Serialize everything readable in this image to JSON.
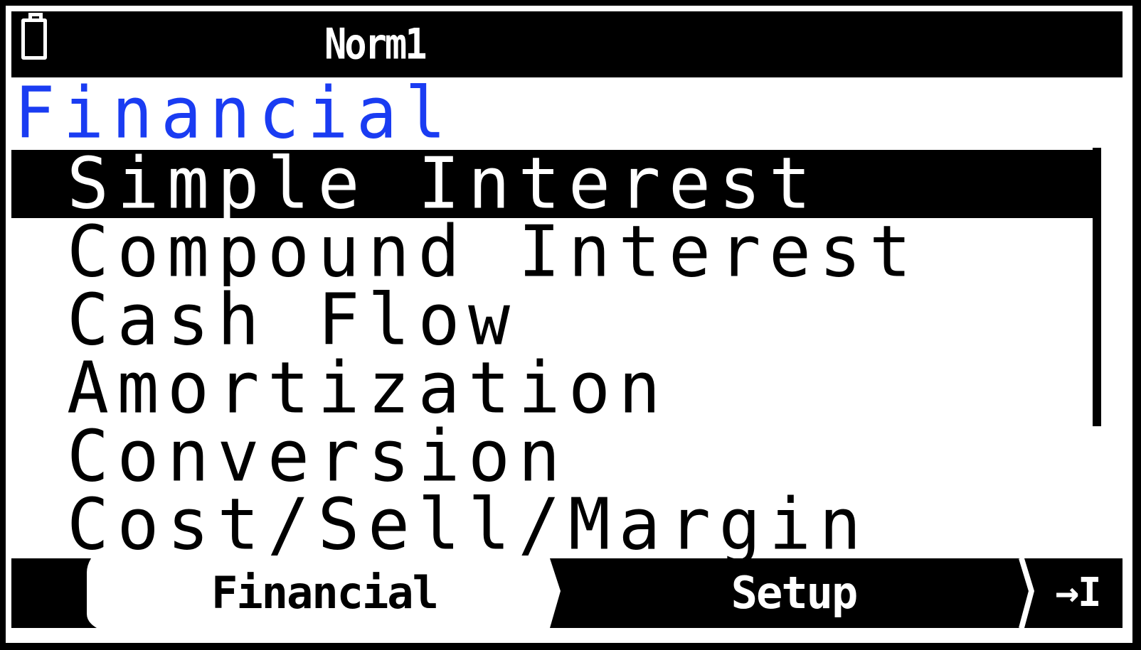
{
  "status_bar": {
    "battery_icon": "battery-icon",
    "mode": "Norm1"
  },
  "heading": "Financial",
  "menu": {
    "selected_index": 0,
    "items": [
      {
        "label": "Simple Interest"
      },
      {
        "label": "Compound Interest"
      },
      {
        "label": "Cash Flow"
      },
      {
        "label": "Amortization"
      },
      {
        "label": "Conversion"
      },
      {
        "label": "Cost/Sell/Margin"
      }
    ]
  },
  "softkeys": {
    "financial": "Financial",
    "setup": "Setup",
    "more": "→I"
  },
  "colors": {
    "heading": "#1a3cf2",
    "background": "#ffffff",
    "inverse": "#000000"
  }
}
